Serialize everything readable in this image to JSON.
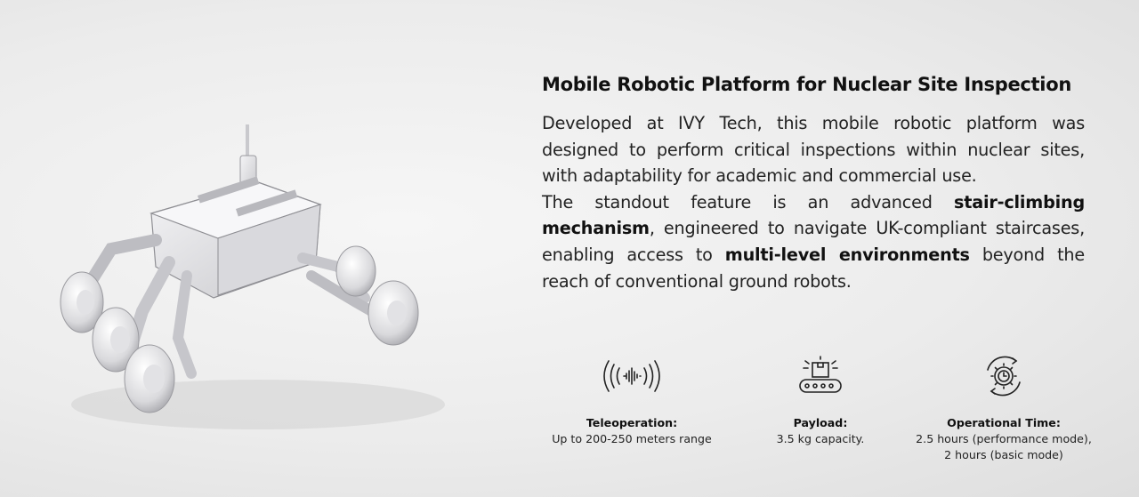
{
  "heading": "Mobile Robotic Platform for Nuclear Site Inspection",
  "paragraph1": "Developed at IVY Tech, this mobile robotic platform was designed to perform critical inspections within nuclear sites, with adaptability for academic and commercial use.",
  "paragraph2": {
    "part1": "The standout feature is an advanced ",
    "bold1": "stair-climbing mechanism",
    "part2": ", engineered to navigate UK-compliant staircases, enabling access to ",
    "bold2": "multi-level environments",
    "part3": " beyond the reach of conventional ground robots."
  },
  "features": [
    {
      "icon": "signal-wave-icon",
      "label": "Teleoperation:",
      "value": "Up to 200-250 meters range",
      "value2": ""
    },
    {
      "icon": "conveyor-box-icon",
      "label": "Payload:",
      "value": "3.5 kg capacity.",
      "value2": ""
    },
    {
      "icon": "gear-clock-icon",
      "label": "Operational Time:",
      "value": "2.5 hours (performance mode),",
      "value2": "2 hours (basic mode)"
    }
  ]
}
